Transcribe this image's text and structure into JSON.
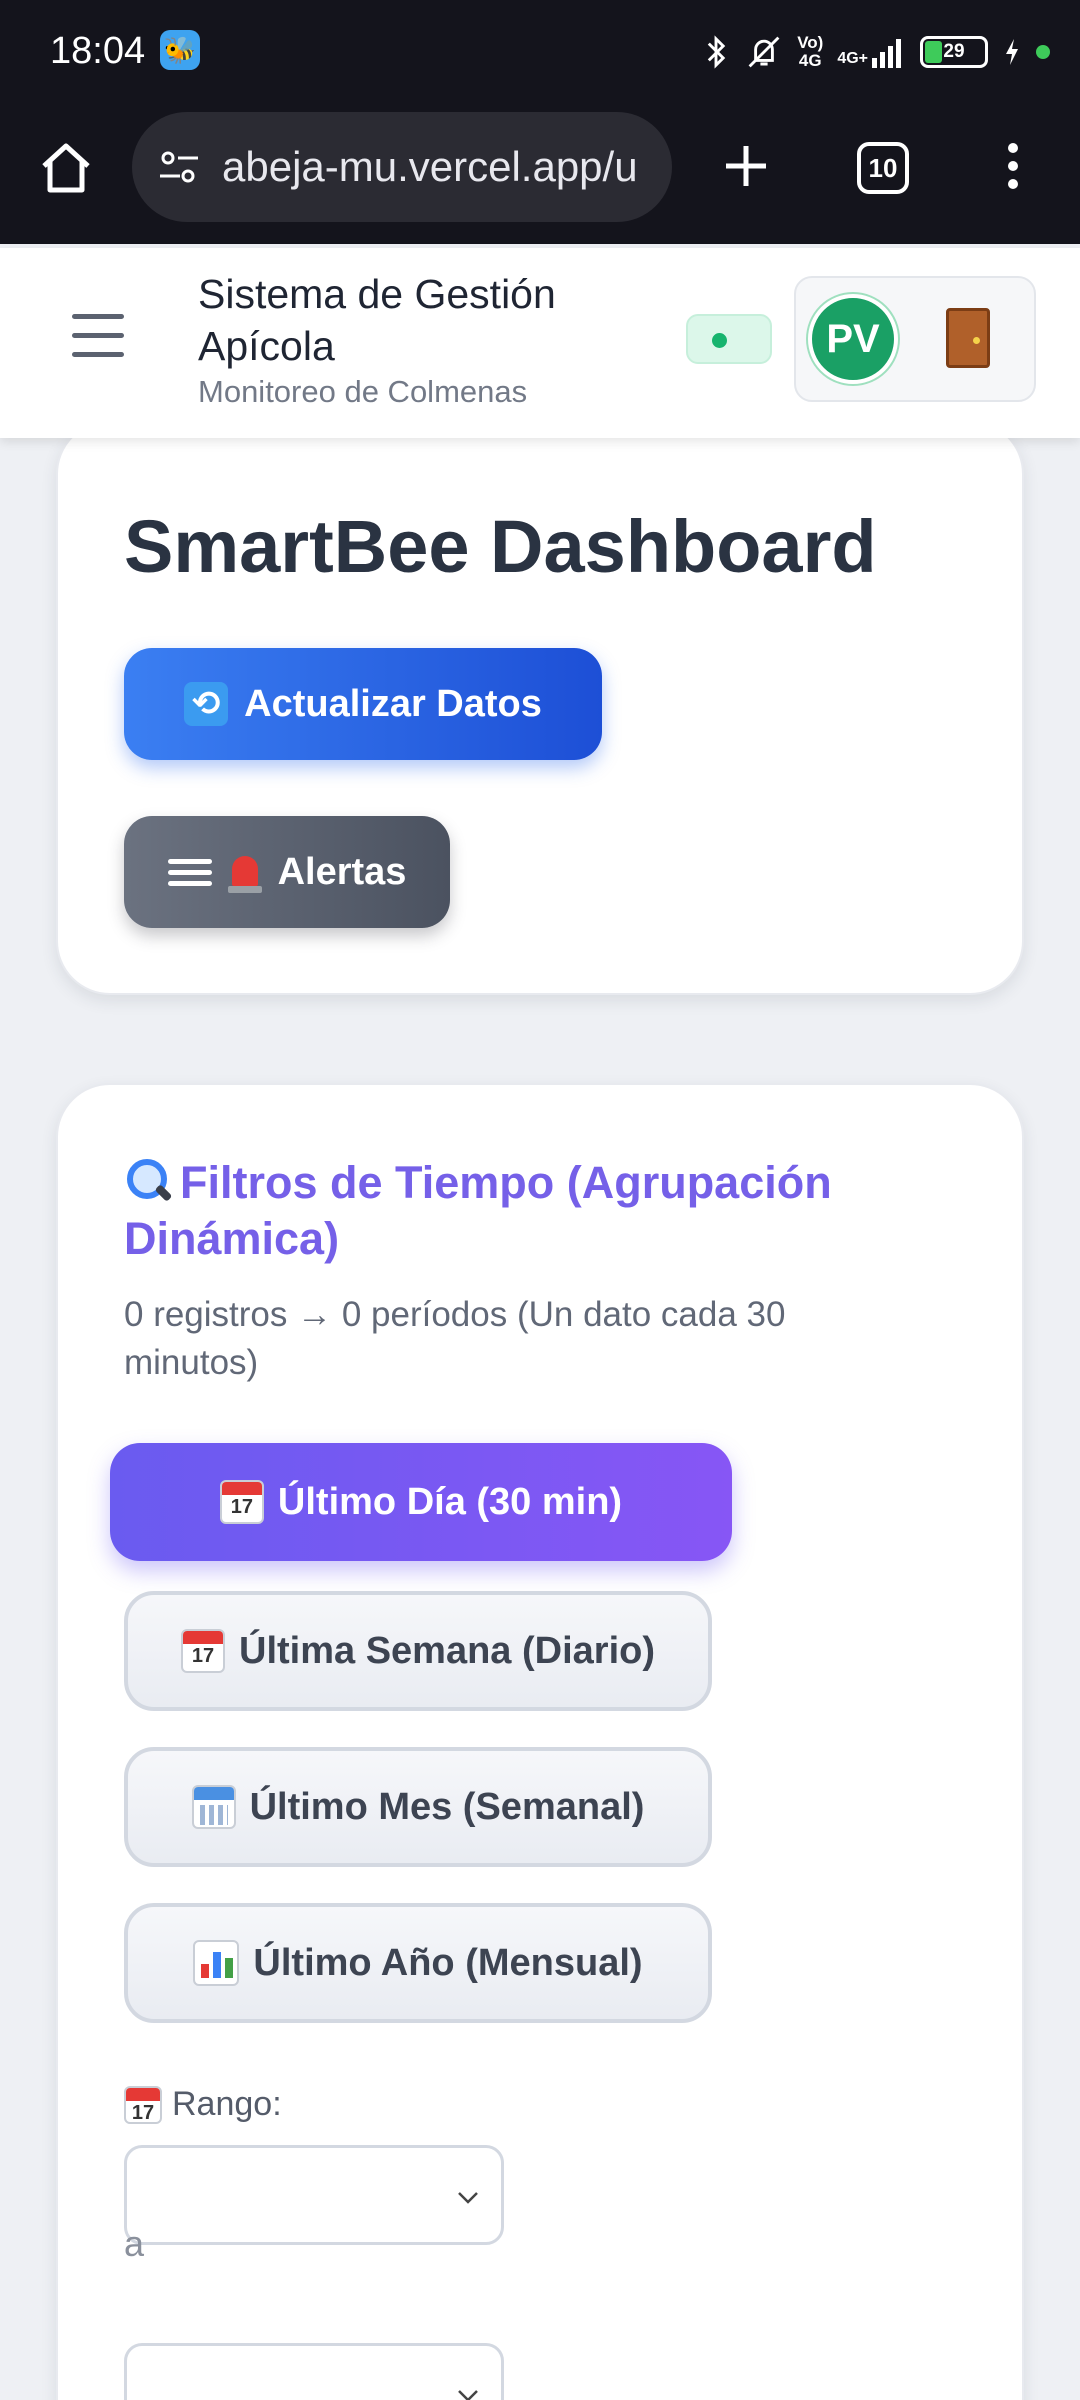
{
  "status_bar": {
    "time": "18:04",
    "network_top": "Vo)",
    "network_bottom": "4G",
    "data_top": "4G+",
    "battery": "29",
    "battery_level_percent": 29
  },
  "browser": {
    "url": "abeja-mu.vercel.app/u",
    "tab_count": "10",
    "icons": [
      "home-icon",
      "site-settings-icon",
      "new-tab-icon",
      "tab-switcher-icon",
      "more-options-icon"
    ]
  },
  "header": {
    "title": "Sistema de Gestión Apícola",
    "subtitle": "Monitoreo de Colmenas",
    "avatar_initials": "PV",
    "connection_status_color": "#17b46e"
  },
  "dashboard": {
    "title": "SmartBee Dashboard",
    "refresh_label": "Actualizar Datos",
    "alerts_label": "Alertas"
  },
  "filters": {
    "title": "Filtros de Tiempo (Agrupación Dinámica)",
    "summary": "0 registros → 0 períodos (Un dato cada 30 minutos)",
    "periods": [
      {
        "label": "Último Día (30 min)",
        "active": true
      },
      {
        "label": "Última Semana (Diario)",
        "active": false
      },
      {
        "label": "Último Mes (Semanal)",
        "active": false
      },
      {
        "label": "Último Año (Mensual)",
        "active": false
      }
    ],
    "range_label": "Rango:",
    "range_separator": "a",
    "range_start": "",
    "range_end": ""
  },
  "colors": {
    "primary_blue": "#2563eb",
    "accent_purple": "#7560e8",
    "alerts_gray": "#5b6270",
    "avatar_green": "#1aa065"
  }
}
